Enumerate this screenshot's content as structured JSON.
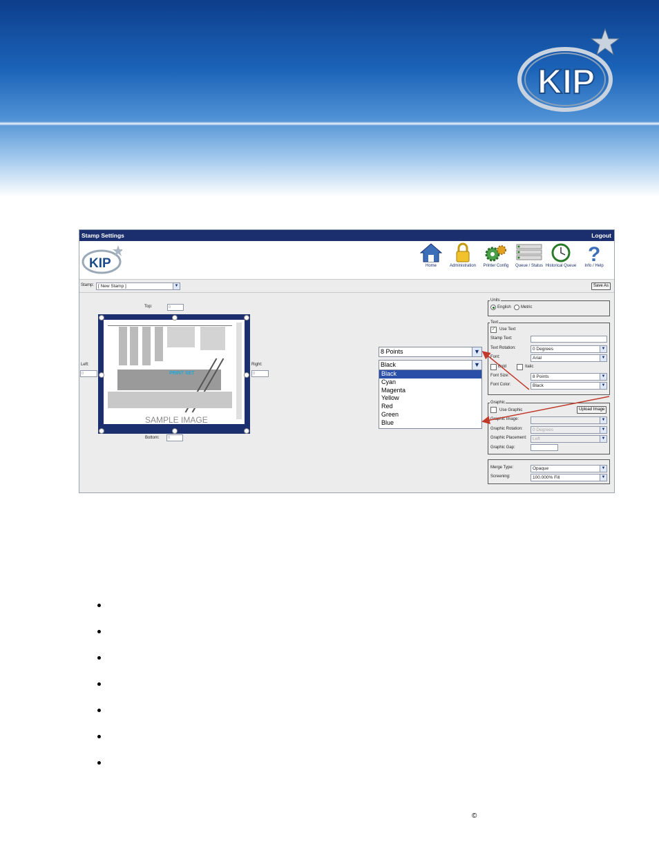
{
  "window": {
    "title": "Stamp Settings",
    "logout": "Logout"
  },
  "logo_text": "KIP",
  "toolbar": [
    {
      "label": "Home",
      "icon": "home-icon"
    },
    {
      "label": "Administration",
      "icon": "padlock-icon"
    },
    {
      "label": "Printer Config",
      "icon": "gears-icon"
    },
    {
      "label": "Queue / Status",
      "icon": "queue-list-icon"
    },
    {
      "label": "Historical Queue",
      "icon": "clock-history-icon"
    },
    {
      "label": "Info / Help",
      "icon": "question-icon"
    }
  ],
  "stamp": {
    "label": "Stamp:",
    "value": "[ New Stamp ]",
    "save_as": "Save As"
  },
  "margins": {
    "top_label": "Top:",
    "top_value": "0",
    "left_label": "Left:",
    "left_value": "0",
    "right_label": "Right:",
    "right_value": "0",
    "bottom_label": "Bottom:",
    "bottom_value": "0"
  },
  "preview": {
    "stamp_text": "PRINT SET",
    "watermark": "SAMPLE IMAGE"
  },
  "units": {
    "legend": "Units",
    "english": "English",
    "metric": "Metric",
    "selected": "English"
  },
  "text_group": {
    "legend": "Text",
    "use_text": "Use Text",
    "stamp_text_label": "Stamp Text:",
    "stamp_text_value": "",
    "rotation_label": "Text Rotation:",
    "rotation_value": "0 Degrees",
    "font_label": "Font:",
    "font_value": "Arial",
    "bold": "Bold",
    "italic": "Italic",
    "font_size_label": "Font Size:",
    "font_size_value": "8 Points",
    "font_color_label": "Font Color:",
    "font_color_value": "Black"
  },
  "graphic_group": {
    "legend": "Graphic",
    "use_graphic": "Use Graphic",
    "upload": "Upload Image",
    "image_label": "Graphic Image:",
    "image_value": "",
    "rotation_label": "Graphic Rotation:",
    "rotation_value": "0 Degrees",
    "placement_label": "Graphic Placement:",
    "placement_value": "Left",
    "gap_label": "Graphic Gap:",
    "gap_value": ""
  },
  "merge_group": {
    "merge_label": "Merge Type:",
    "merge_value": "Opaque",
    "screening_label": "Screening:",
    "screening_value": "100.000% Fill"
  },
  "popup": {
    "size_value": "8 Points",
    "color_value": "Black",
    "color_options": [
      "Black",
      "Cyan",
      "Magenta",
      "Yellow",
      "Red",
      "Green",
      "Blue"
    ],
    "selected": "Black"
  },
  "footer": {
    "copyright": "©"
  },
  "colors": {
    "title_bar": "#1b2f6e",
    "arrow": "#c0392b",
    "selection": "#2a4fa8"
  }
}
